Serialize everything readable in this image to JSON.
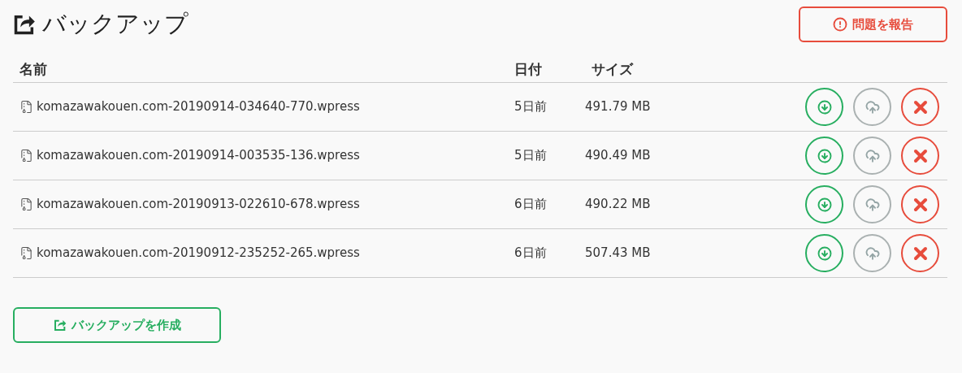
{
  "title": "バックアップ",
  "report_button": "問題を報告",
  "table": {
    "columns": [
      "名前",
      "日付",
      "サイズ"
    ],
    "rows": [
      {
        "name": "komazawakouen.com-20190914-034640-770.wpress",
        "date": "5日前",
        "size": "491.79 MB"
      },
      {
        "name": "komazawakouen.com-20190914-003535-136.wpress",
        "date": "5日前",
        "size": "490.49 MB"
      },
      {
        "name": "komazawakouen.com-20190913-022610-678.wpress",
        "date": "6日前",
        "size": "490.22 MB"
      },
      {
        "name": "komazawakouen.com-20190912-235252-265.wpress",
        "date": "6日前",
        "size": "507.43 MB"
      }
    ]
  },
  "create_button": "バックアップを作成"
}
